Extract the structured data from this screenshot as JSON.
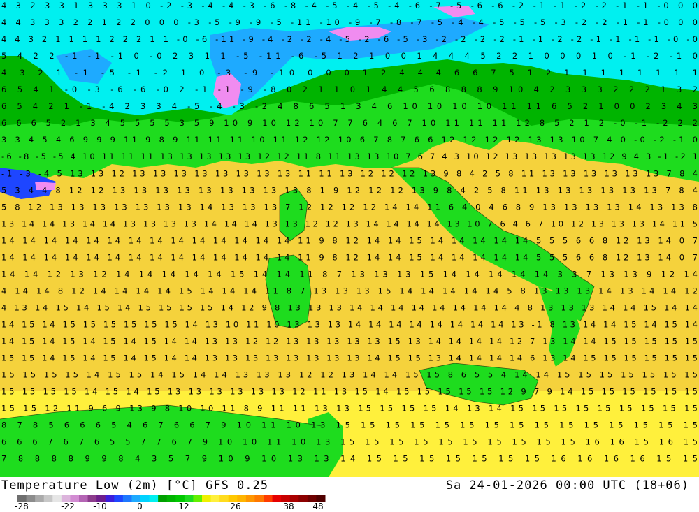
{
  "title": "Temperature Low (2m) [°C] GFS 0.25",
  "datetime": "Sa 24-01-2026 00:00 UTC (18+06)",
  "legend": {
    "ticks": [
      "-28",
      "-22",
      "-10",
      "0",
      "12",
      "26",
      "38",
      "48"
    ],
    "colors": [
      "#6e6e6e",
      "#8c8c8c",
      "#aaaaaa",
      "#c8c8c8",
      "#e6e6e6",
      "#dcb4dc",
      "#d28cd2",
      "#b464b4",
      "#8c3c8c",
      "#6e1e8c",
      "#3c1edc",
      "#1e46ff",
      "#1e78ff",
      "#1eaaff",
      "#00d2ff",
      "#00f0f0",
      "#00a000",
      "#00b400",
      "#00c800",
      "#1edc1e",
      "#64f000",
      "#f0f000",
      "#fff03c",
      "#ffdc1e",
      "#ffc800",
      "#ffb400",
      "#ff9600",
      "#ff7800",
      "#ff3c00",
      "#e60000",
      "#c80000",
      "#aa0000",
      "#8c0000",
      "#6e0000",
      "#500000"
    ]
  },
  "map_colors": {
    "sea_warm": "#f5d23c",
    "sea_mid": "#fff03c",
    "land_mild": "#1edc1e",
    "land_cool": "#00b400",
    "cold": "#00f0f0",
    "cold2": "#1eaaff",
    "very_cold": "#1e46ff",
    "frost": "#f08cf0"
  },
  "labels": [
    {
      "t": "4 3 2 3 3 1 3 3 3 1 0 -2 -3 -4 -4 -3 -6 -8 -4 -5 -4 -5 -4 -6 -7 -5 -6 -6 -2 -1 -1 -2 -2 -1 -1 -0 0 0"
    },
    {
      "t": "4 4 3 3 3 2 2 1 2 2 0 0 0 -3 -5 -9 -9 -5 -11 -10 -9 -7 -8 -7 -5 -4 -4 -5 -5 -5 -3 -2 -2 -1 -1 -0 0 0"
    },
    {
      "t": "4 4 3 2 1 1 1 1 2 2 2 1 1 -0 -6 -11 -9 -4 -2 -2 -4 -5 -2 -6 -5 -3 -2 -2 -2 -2 -1 -1 -2 -2 -1 -1 -1 -1 -0 -0"
    },
    {
      "t": "5 4 2 2 -1 -1 -1 0 -0 2 3 1 1 -5 -11 -6 -5 1 2 1 0 0 1 4 4 4 5 2 2 1 0 0 0 1 0 -1 -2 -1 0"
    },
    {
      "t": "4 3 2 1 -1 -5 -1 -2 1 0 -3 -9 -10 0 0 0 1 2 4 4 4 6 6 7 5 1 2 1 1 1 1 1 1 1 1"
    },
    {
      "t": "6 5 4 1 -0 -3 -6 -6 -0 2 -1 -1 -9 -8 0 2 1 1 0 1 4 4 5 6 8 8 8 9 10 4 2 3 3 3 2 2 2 1 3 2"
    },
    {
      "t": "6 5 4 2 1 -1 -4 2 3 3 4 -5 -4 -3 -2 4 8 6 5 1 3 4 6 10 10 10 10 11 11 6 5 2 1 0 0 2 3 4 3"
    },
    {
      "t": "6 6 6 5 2 1 3 4 5 5 5 5 3 5 9 10 9 10 12 10 7 7 6 4 6 7 10 11 11 11 12 8 5 2 1 2 -0 -1 -2 2 2"
    },
    {
      "t": "3 3 4 5 4 6 9 9 9 11 9 8 9 11 11 11 10 11 12 12 10 6 7 8 7 6 6 12 12 12 12 13 13 10 7 4 0 -0 -2 -1 0"
    },
    {
      "t": "-6 -8 -5 -5 4 10 11 11 11 13 13 13 13 13 12 12 11 8 11 13 13 10 7 6 7 4 3 10 12 13 13 13 13 13 12 9 4 3 -1 -2 1"
    },
    {
      "t": "-1 -3 -4 5 13 13 12 13 13 13 13 13 13 13 13 11 11 13 12 12 12 13 9 8 4 2 5 8 11 13 13 13 13 13 13 7 8 4"
    },
    {
      "t": "5 3 4 4 8 12 12 13 13 13 13 13 13 13 13 13 8 1 9 12 12 12 13 9 8 4 2 5 8 11 13 13 13 13 13 13 7 8 4"
    },
    {
      "t": "5 8 12 13 13 13 13 13 13 13 14 13 13 13 7 12 12 12 12 14 14 11 6 4 0 4 6 8 9 13 13 13 13 14 13 13 8"
    },
    {
      "t": "13 14 14 13 14 14 13 13 13 13 14 14 14 13 13 12 12 13 14 14 14 14 13 10 7 6 4 6 7 10 12 13 13 13 14 11 5"
    },
    {
      "t": "14 14 14 14 14 14 14 14 14 14 14 14 14 14 11 9 8 12 14 14 15 14 14 14 14 14 5 5 5 6 6 8 12 13 14 0 7"
    },
    {
      "t": "14 14 14 14 14 14 14 14 14 14 14 14 14 14 11 9 8 12 14 14 15 14 14 14 14 14 5 5 5 6 6 8 12 13 14 0 7"
    },
    {
      "t": "14 14 12 13 12 14 14 14 14 14 15 14 14 11 8 7 13 13 13 15 14 14 14 14 14 3 3 7 13 13 9 12 14"
    },
    {
      "t": "4 14 14 8 12 14 14 14 14 15 14 14 14 11 8 7 13 13 13 15 14 14 14 14 14 5 8 13 13 13 14 13 14 14 12"
    },
    {
      "t": "4 13 14 15 14 15 14 15 15 15 15 14 12 9 8 13 13 13 14 14 14 14 14 14 14 14 4 8 13 13 13 14 14 15 14 14"
    },
    {
      "t": "14 15 14 15 15 15 15 15 15 14 13 10 11 10 13 13 13 14 14 14 14 14 14 14 14 13 -1 8 13 14 14 15 14 15 14"
    },
    {
      "t": "14 15 14 15 14 15 14 15 14 14 13 13 12 12 13 13 13 13 13 15 13 14 14 14 14 12 7 13 14 14 15 15 15 15 15"
    },
    {
      "t": "15 15 14 15 14 15 14 15 14 14 13 13 13 13 13 13 13 13 14 15 15 13 14 14 14 14 6 13 14 15 15 15 15 15 15"
    },
    {
      "t": "15 15 15 15 14 15 15 14 15 14 14 13 13 13 12 12 13 14 14 15 15 8 6 5 5 4 14 14 15 15 15 15 15 15 15"
    },
    {
      "t": "15 15 15 15 14 15 14 15 13 13 13 13 13 13 12 11 13 15 14 15 15 15 15 15 12 9 7 9 14 15 15 15 15 15 15"
    },
    {
      "t": "15 15 12 11 9 6 9 13 9 8 10 10 11 8 9 11 11 13 13 15 15 15 15 14 13 14 15 15 15 15 15 15 15 15 15"
    },
    {
      "t": "8 7 8 5 6 6 6 5 4 6 7 6 6 7 9 10 11 10 13 15 15 15 15 15 15 15 15 15 15 15 15 15 15 15"
    },
    {
      "t": "6 6 6 7 6 7 6 5 5 7 7 6 7 9 10 10 11 10 13 15 15 15 15 15 15 15 15 15 15 16 16 15 16 15"
    },
    {
      "t": "7 8 8 8 8 9 9 8 4 3 5 7 9 10 9 10 13 13 14 15 15 15 15 15 15 15 16 16 16 16 15 15"
    }
  ]
}
